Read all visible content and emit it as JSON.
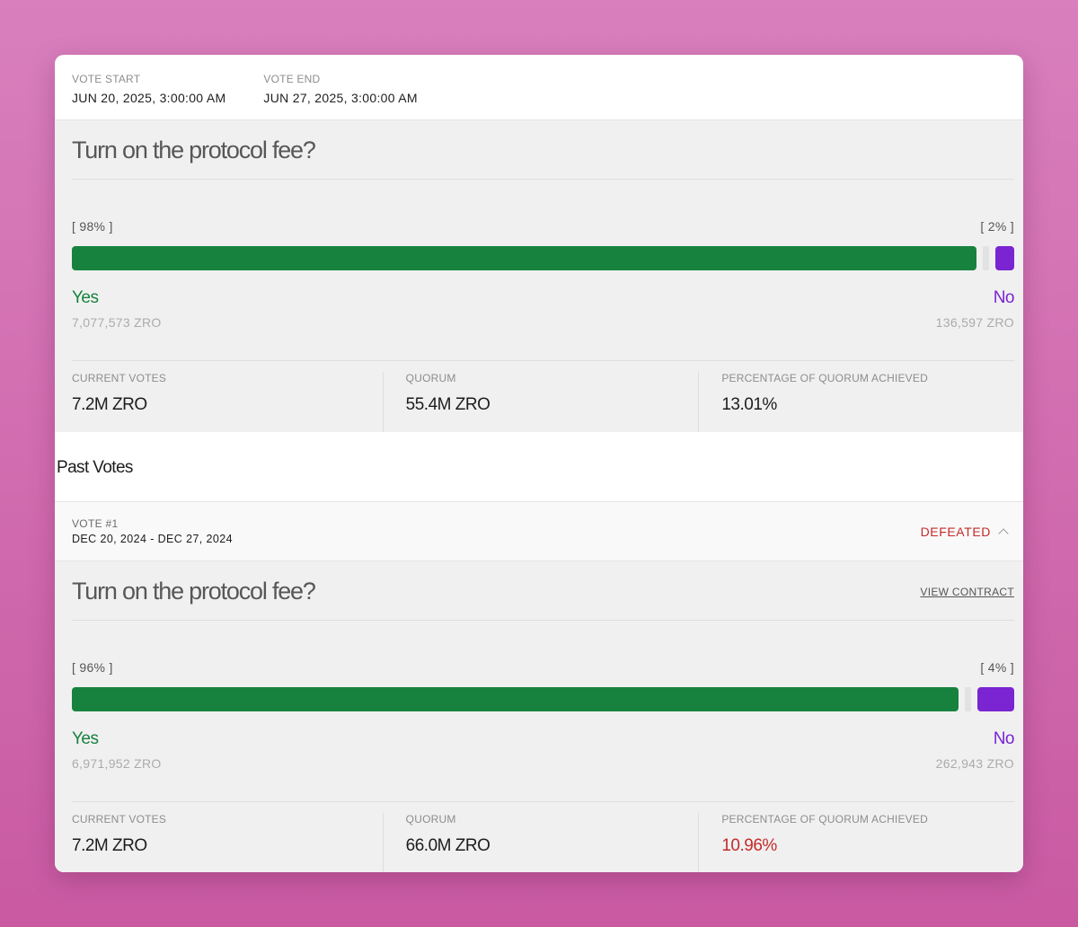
{
  "current": {
    "vote_start_label": "VOTE START",
    "vote_start": "JUN 20, 2025, 3:00:00 AM",
    "vote_end_label": "VOTE END",
    "vote_end": "JUN 27, 2025, 3:00:00 AM",
    "question": "Turn on the protocol fee?",
    "yes_pct": "[ 98% ]",
    "no_pct": "[ 2% ]",
    "yes_share": 0.98,
    "no_share": 0.02,
    "yes_label": "Yes",
    "no_label": "No",
    "yes_amount": "7,077,573 ZRO",
    "no_amount": "136,597 ZRO",
    "stats": {
      "current_votes_label": "CURRENT VOTES",
      "current_votes": "7.2M ZRO",
      "quorum_label": "QUORUM",
      "quorum": "55.4M ZRO",
      "pct_quorum_label": "PERCENTAGE OF QUORUM ACHIEVED",
      "pct_quorum": "13.01%"
    }
  },
  "past": {
    "title": "Past Votes",
    "vote_num": "VOTE #1",
    "range": "DEC 20, 2024 - DEC 27, 2024",
    "status": "DEFEATED",
    "question": "Turn on the protocol fee?",
    "view_contract": "VIEW CONTRACT",
    "yes_pct": "[ 96% ]",
    "no_pct": "[ 4% ]",
    "yes_share": 0.96,
    "no_share": 0.04,
    "yes_label": "Yes",
    "no_label": "No",
    "yes_amount": "6,971,952 ZRO",
    "no_amount": "262,943 ZRO",
    "stats": {
      "current_votes_label": "CURRENT VOTES",
      "current_votes": "7.2M ZRO",
      "quorum_label": "QUORUM",
      "quorum": "66.0M ZRO",
      "pct_quorum_label": "PERCENTAGE OF QUORUM ACHIEVED",
      "pct_quorum": "10.96%"
    }
  },
  "colors": {
    "yes": "#17823e",
    "no": "#7a24d2",
    "defeated": "#c42b2b"
  }
}
